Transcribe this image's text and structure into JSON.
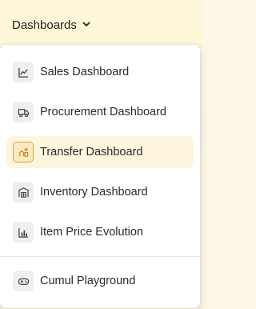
{
  "header": {
    "dashboards_label": "Dashboards"
  },
  "menu": {
    "items": [
      {
        "label": "Sales Dashboard",
        "icon": "line-chart-icon"
      },
      {
        "label": "Procurement Dashboard",
        "icon": "truck-icon"
      },
      {
        "label": "Transfer Dashboard",
        "icon": "transfer-icon",
        "active": true
      },
      {
        "label": "Inventory Dashboard",
        "icon": "warehouse-icon"
      },
      {
        "label": "Item Price Evolution",
        "icon": "bar-chart-icon"
      }
    ],
    "footer_item": {
      "label": "Cumul Playground",
      "icon": "gamepad-icon"
    }
  },
  "colors": {
    "accent": "#d9a43a",
    "active_bg": "#fdf5dd",
    "header_bg": "#fdf6d8"
  }
}
